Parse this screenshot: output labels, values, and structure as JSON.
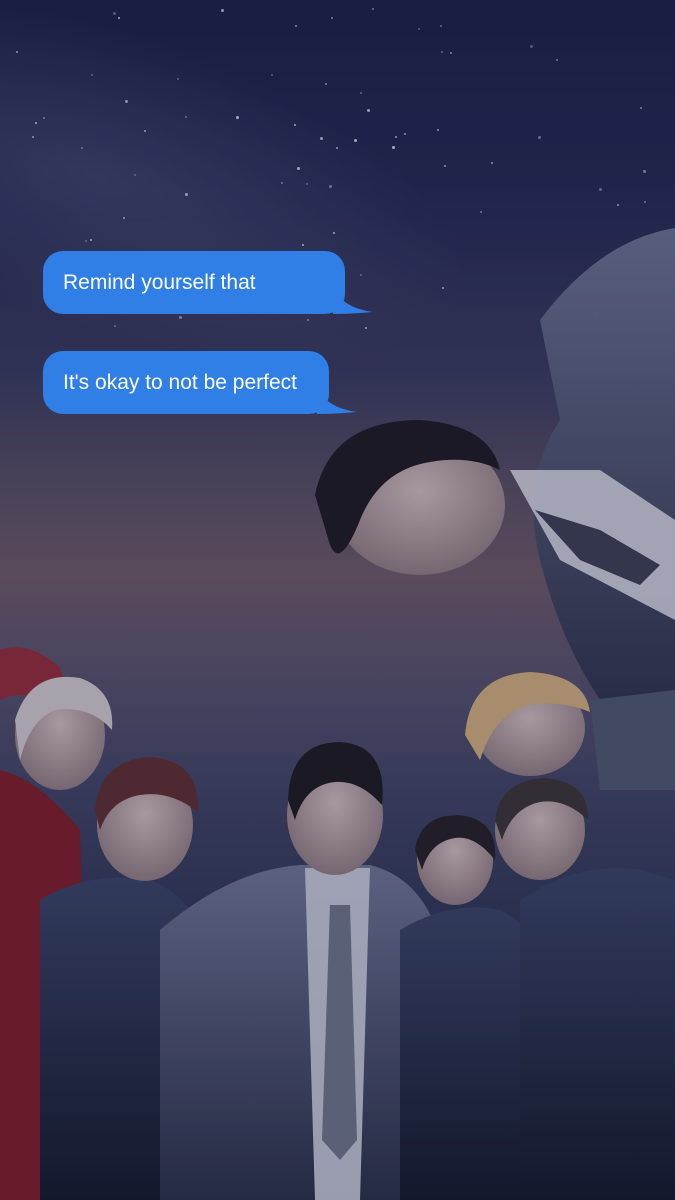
{
  "messages": [
    {
      "text": "Remind yourself that"
    },
    {
      "text": "It's okay to not be perfect"
    }
  ],
  "colors": {
    "bubble": "#2f7fe6",
    "bubble_text": "#ffffff",
    "sky_top": "#1c2146",
    "sky_glow": "#6a5866"
  },
  "background": {
    "scene": "photo of seven young men in suits posing against a starry night sky"
  }
}
